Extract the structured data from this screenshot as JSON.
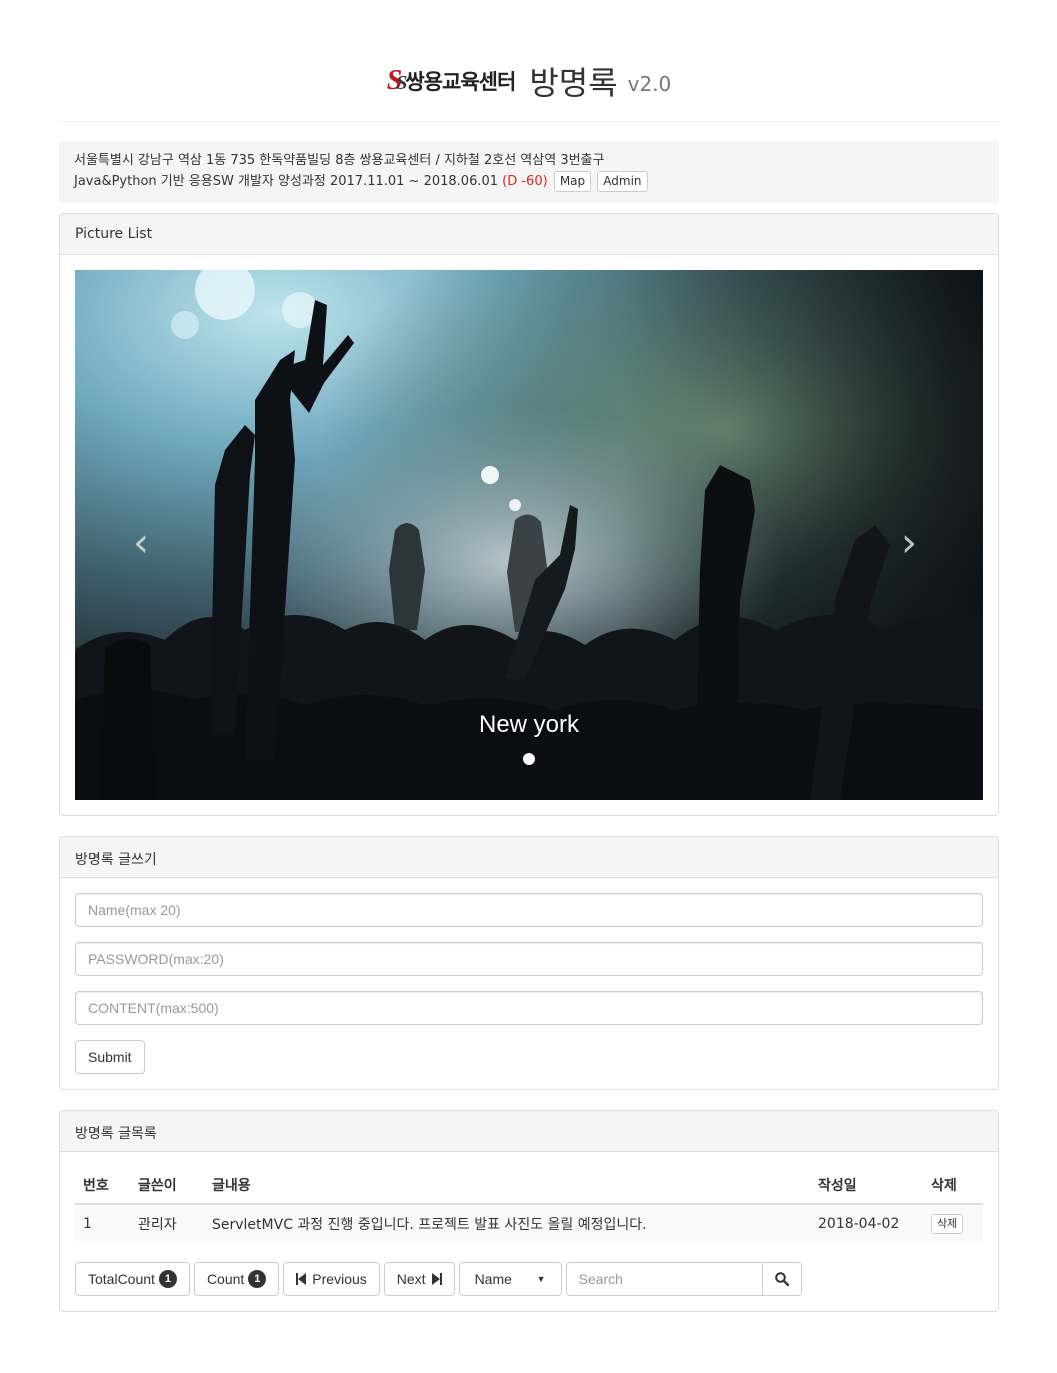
{
  "header": {
    "logo_mark": "SS",
    "logo_text": "쌍용교육센터",
    "title": "방명록",
    "version": "v2.0"
  },
  "info": {
    "address": "서울특별시 강남구 역삼 1동 735 한독약품빌딩 8층 쌍용교육센터 / 지하철 2호선 역삼역 3번출구",
    "course": "Java&Python 기반 응용SW 개발자 양성과정 2017.11.01 ~ 2018.06.01",
    "dday": "(D -60)",
    "map_label": "Map",
    "admin_label": "Admin"
  },
  "picture_panel": {
    "heading": "Picture List",
    "caption": "New york",
    "prev_icon": "chevron-left-icon",
    "next_icon": "chevron-right-icon"
  },
  "write_panel": {
    "heading": "방명록 글쓰기",
    "name_placeholder": "Name(max 20)",
    "password_placeholder": "PASSWORD(max:20)",
    "content_placeholder": "CONTENT(max:500)",
    "submit_label": "Submit"
  },
  "list_panel": {
    "heading": "방명록 글목록",
    "columns": [
      "번호",
      "글쓴이",
      "글내용",
      "작성일",
      "삭제"
    ],
    "rows": [
      {
        "no": "1",
        "author": "관리자",
        "content": "ServletMVC 과정 진행 중입니다. 프로젝트 발표 사진도 올릴 예정입니다.",
        "date": "2018-04-02",
        "delete_label": "삭제"
      }
    ]
  },
  "toolbar": {
    "total_label": "TotalCount",
    "total_value": "1",
    "count_label": "Count",
    "count_value": "1",
    "previous_label": "Previous",
    "next_label": "Next",
    "select_value": "Name",
    "search_placeholder": "Search",
    "search_icon": "search-icon"
  }
}
